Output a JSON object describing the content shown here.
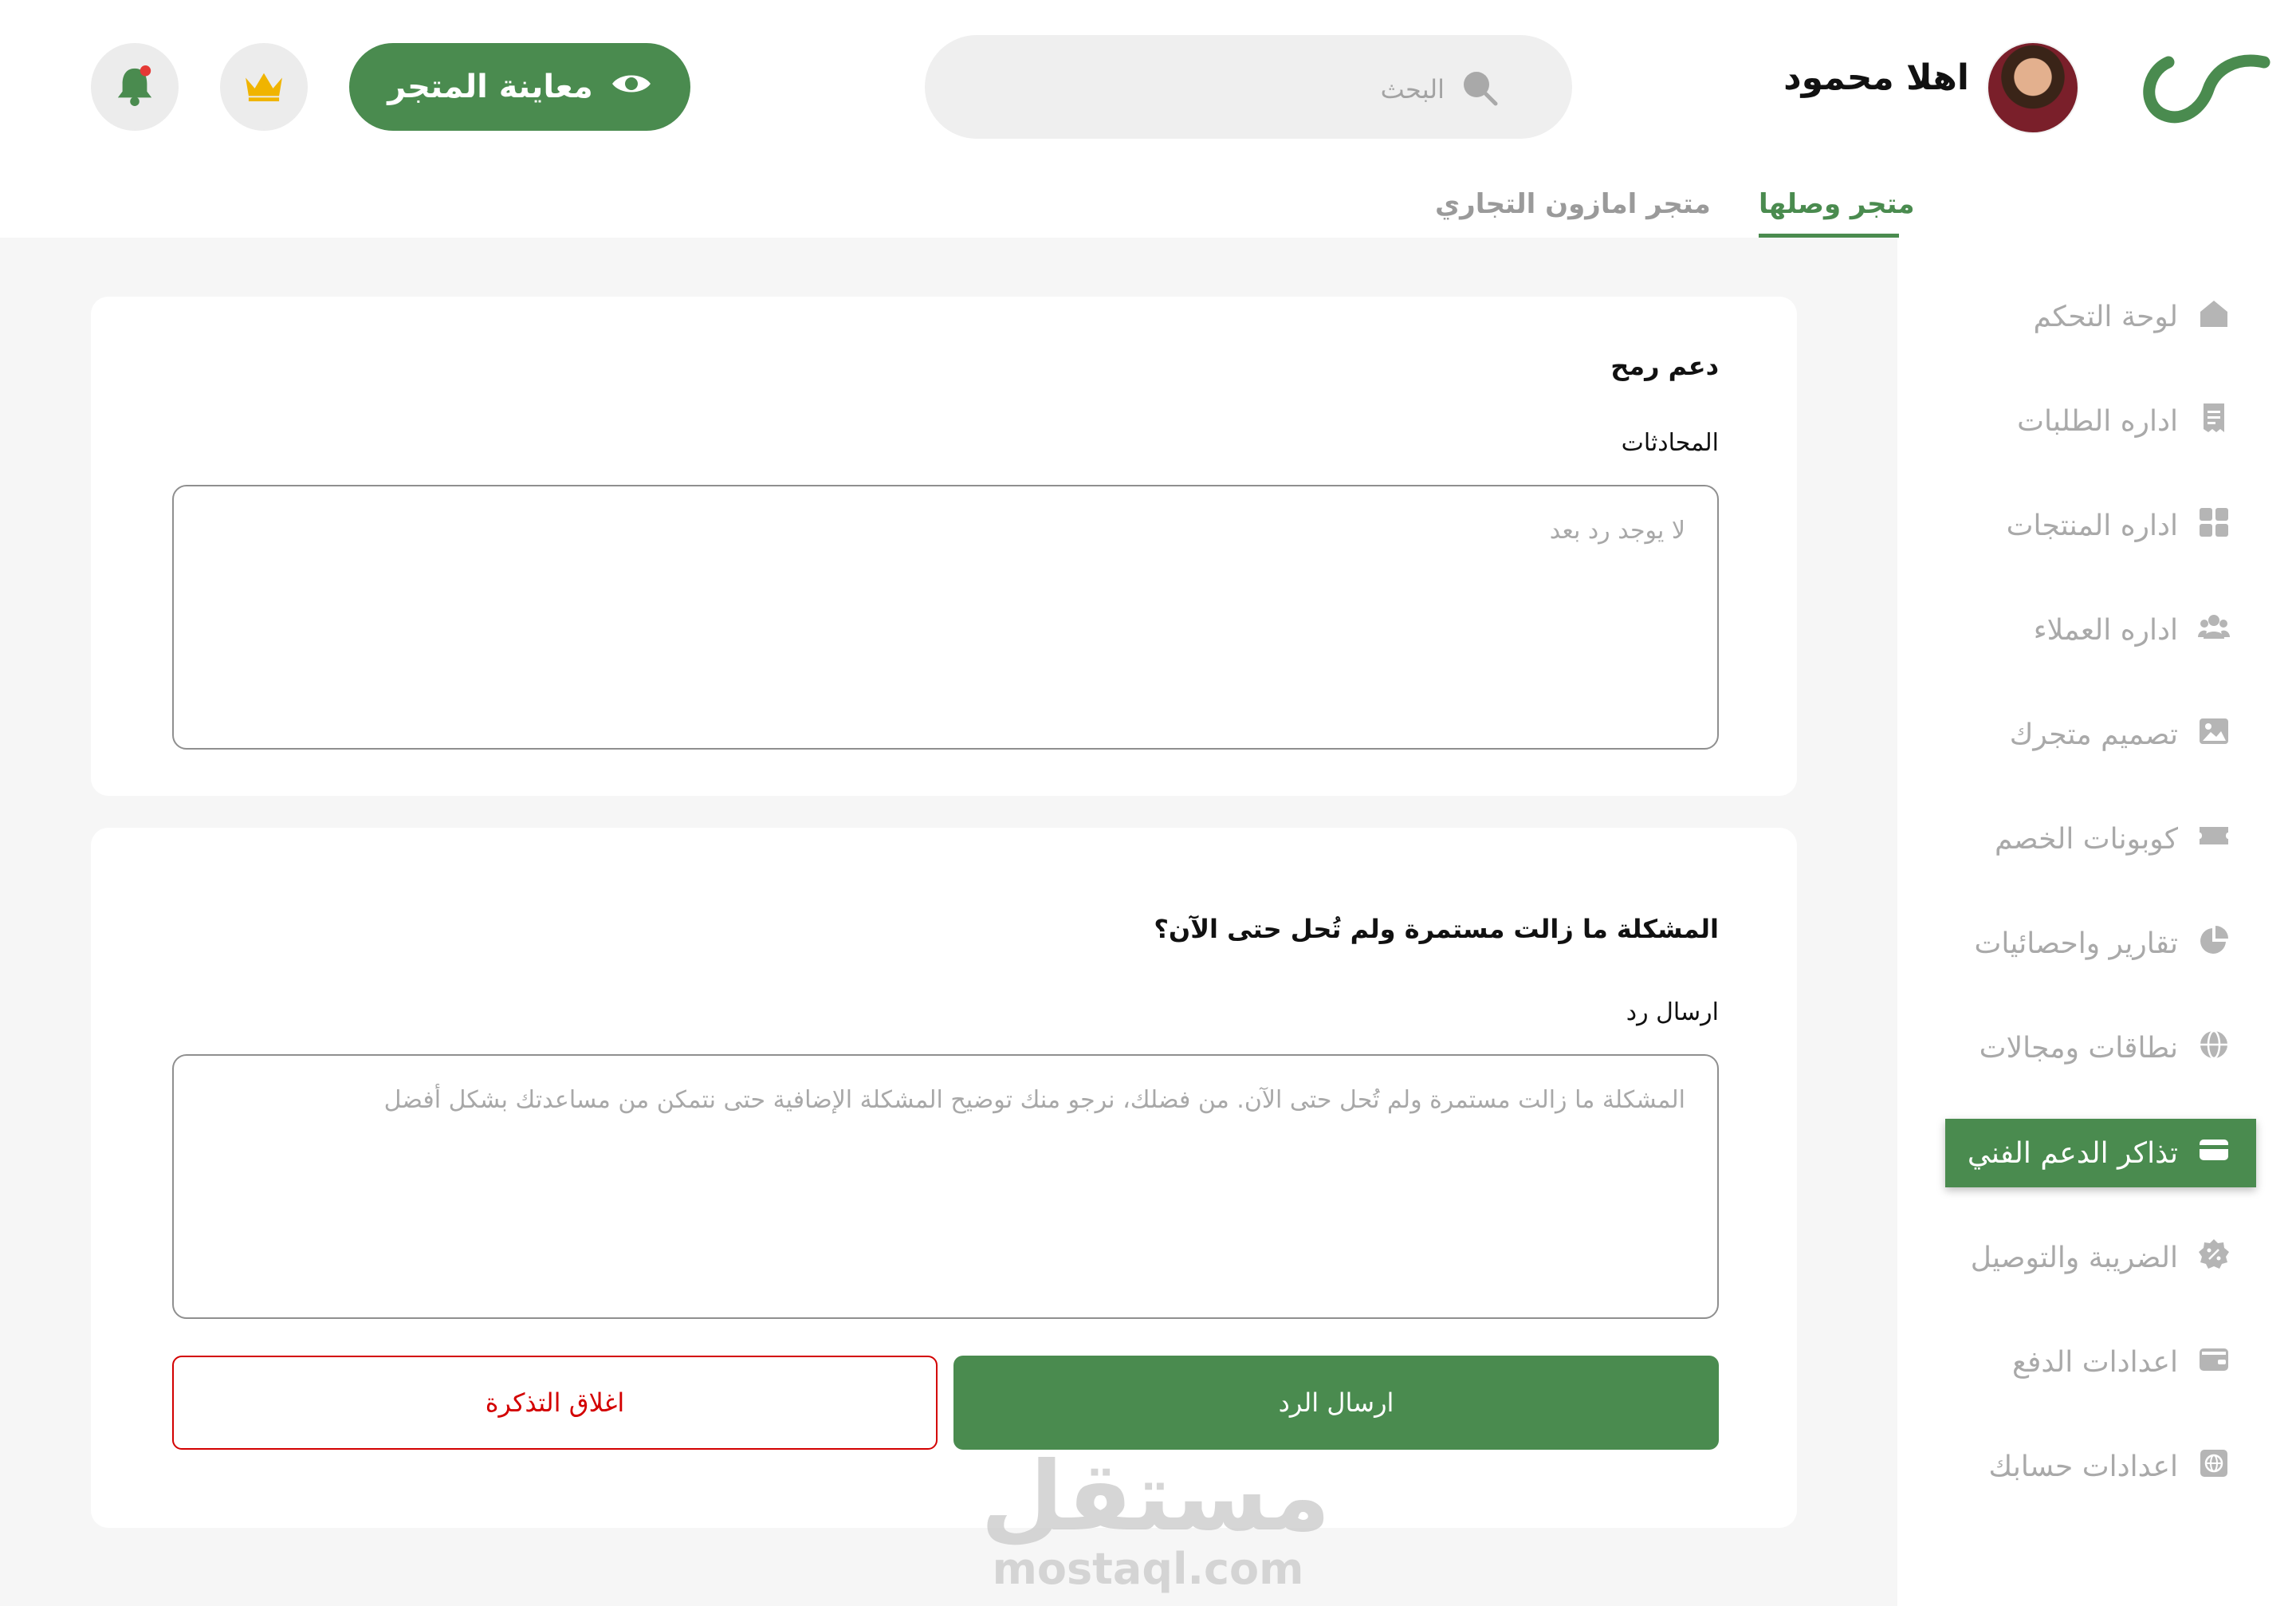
{
  "header": {
    "greeting": "اهلا محمود",
    "search_placeholder": "البحث",
    "preview_store_label": "معاينة المتجر",
    "icons": [
      "logo-icon",
      "avatar",
      "search-icon",
      "eye-icon",
      "crown-icon",
      "bell-icon"
    ],
    "notification_dot_color": "#e53935"
  },
  "store_tabs": {
    "active": "متجر وصلها",
    "inactive": "متجر امازون التجاري"
  },
  "support_card": {
    "title": "دعم رمح",
    "conversations_label": "المحادثات",
    "conversations_empty": "لا يوجد رد بعد"
  },
  "reply_card": {
    "title": "المشكلة ما زالت مستمرة ولم تُحل حتى الآن؟",
    "reply_label": "ارسال رد",
    "reply_placeholder": "المشكلة ما زالت مستمرة ولم تُحل حتى الآن. من فضلك، نرجو منك توضيح المشكلة الإضافية حتى نتمكن من مساعدتك بشكل أفضل",
    "send_button": "ارسال الرد",
    "close_button": "اغلاق التذكرة"
  },
  "sidebar": {
    "items": [
      {
        "label": "لوحة التحكم",
        "icon": "home-icon"
      },
      {
        "label": "اداره الطلبات",
        "icon": "receipt-icon"
      },
      {
        "label": "اداره المنتجات",
        "icon": "grid-icon"
      },
      {
        "label": "اداره العملاء",
        "icon": "users-icon"
      },
      {
        "label": "تصميم متجرك",
        "icon": "image-icon"
      },
      {
        "label": "كوبونات الخصم",
        "icon": "ticket-icon"
      },
      {
        "label": "تقارير واحصائيات",
        "icon": "pie-chart-icon"
      },
      {
        "label": "نطاقات ومجالات",
        "icon": "globe-icon"
      },
      {
        "label": "تذاكر الدعم الفني",
        "icon": "card-icon",
        "active": true
      },
      {
        "label": "الضريبة والتوصيل",
        "icon": "percent-badge-icon"
      },
      {
        "label": "اعدادات الدفع",
        "icon": "wallet-icon"
      },
      {
        "label": "اعدادات حسابك",
        "icon": "account-globe-icon"
      }
    ]
  },
  "watermark": {
    "arabic": "مستقل",
    "latin": "mostaql.com"
  },
  "colors": {
    "primary": "#4a8b4f",
    "danger": "#d30000",
    "muted_text": "#a9a9a9",
    "page_bg": "#f6f6f6",
    "crown": "#f0b400"
  }
}
